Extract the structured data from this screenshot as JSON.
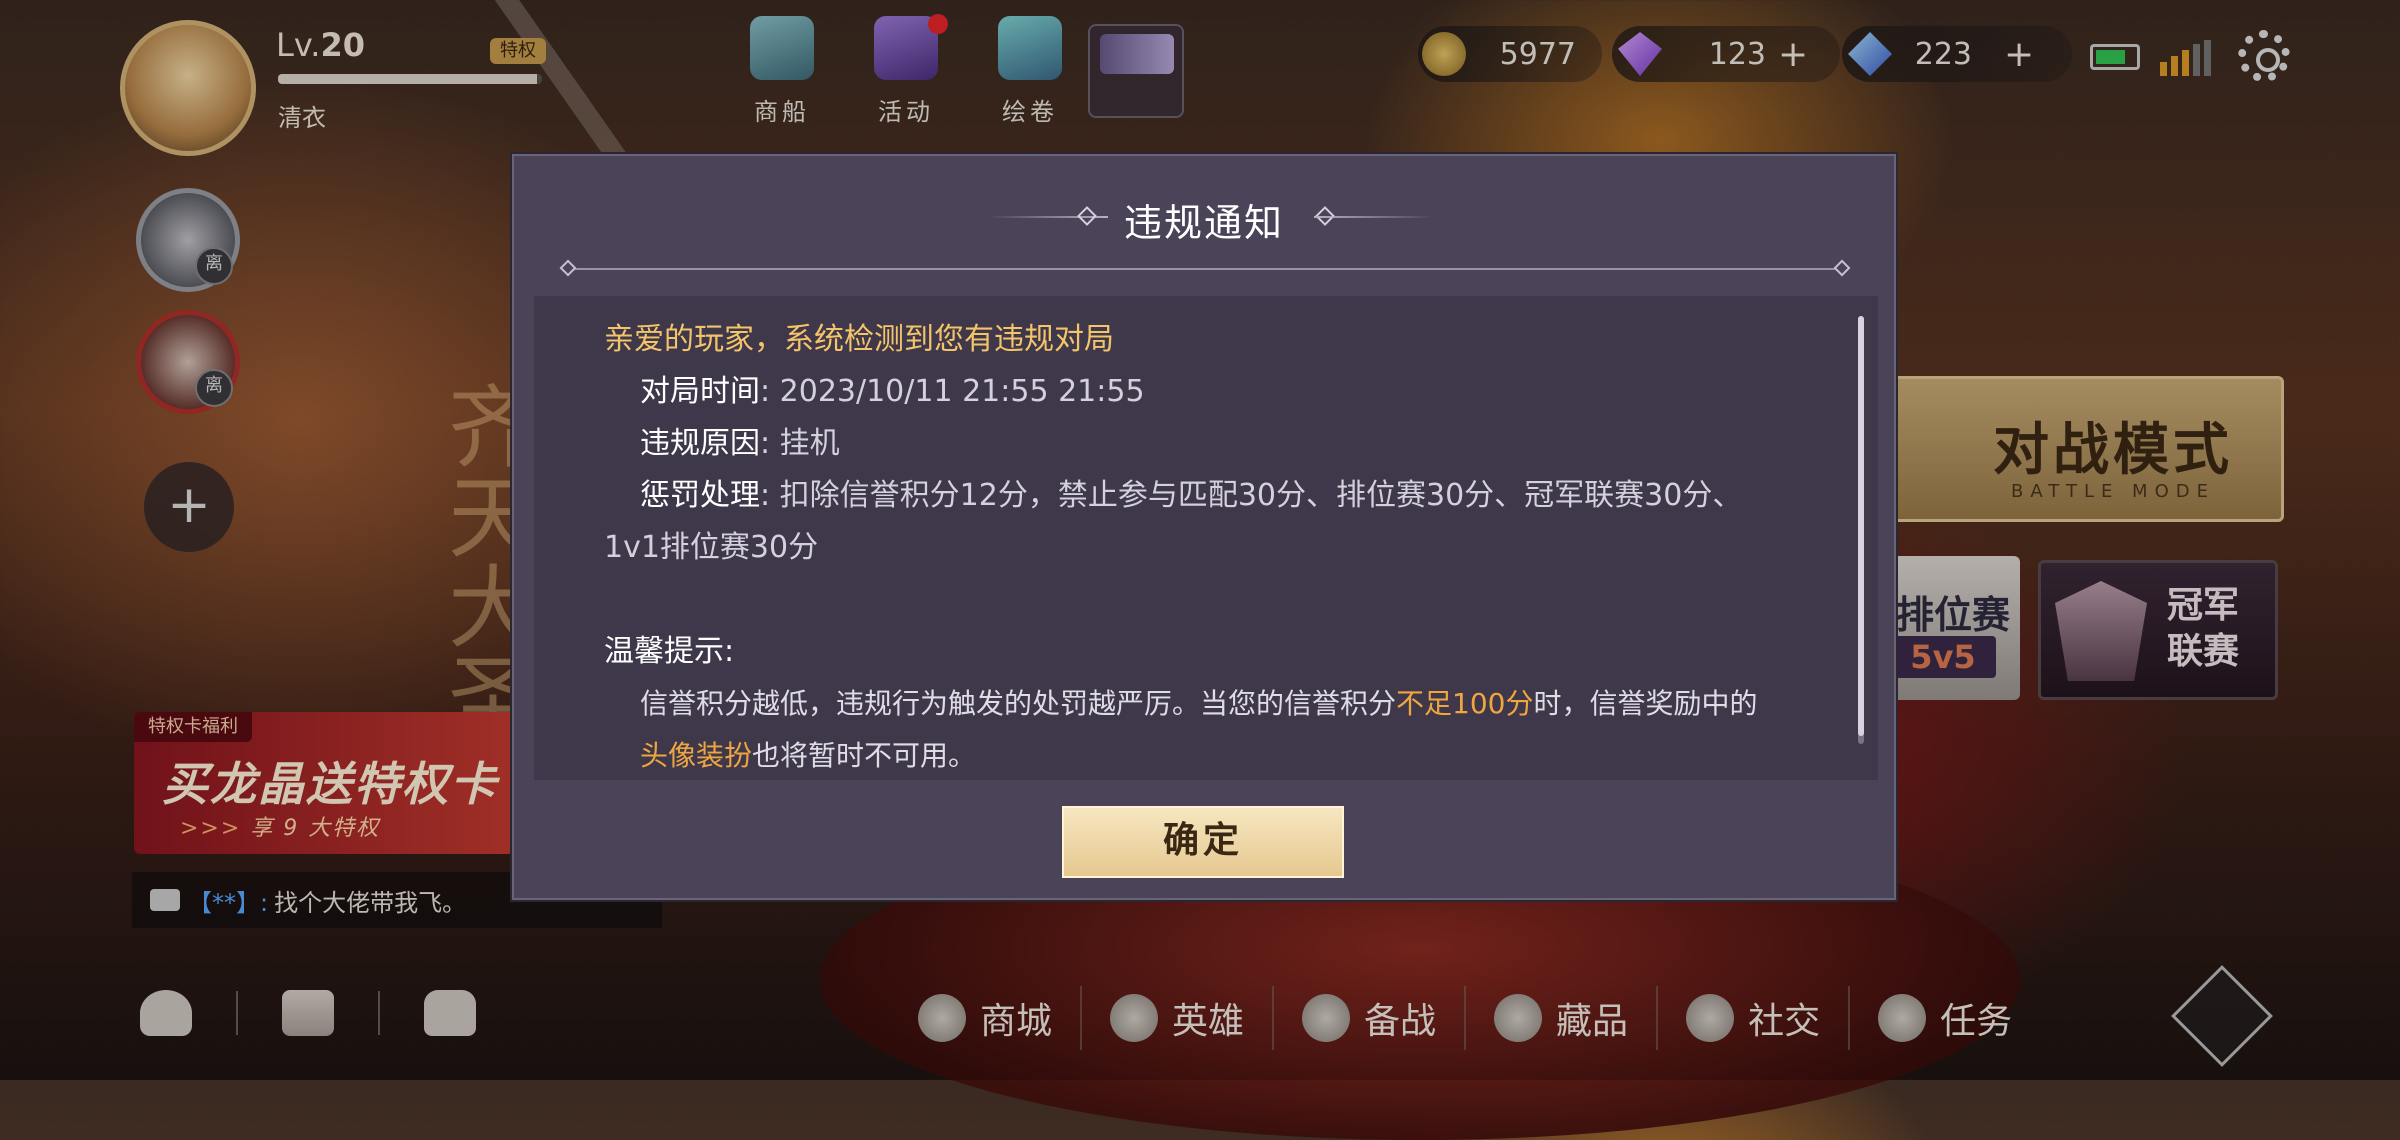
{
  "profile": {
    "level_prefix": "Lv.",
    "level": "20",
    "vip_tag": "特权",
    "name": "清衣",
    "exp_percent": 98
  },
  "friends": {
    "away_badge": "离",
    "add_symbol": "+"
  },
  "topnav": [
    {
      "label": "商船",
      "icon": "ship-icon"
    },
    {
      "label": "活动",
      "icon": "trumpet-icon",
      "notification": true
    },
    {
      "label": "绘卷",
      "icon": "scroll-icon"
    }
  ],
  "currency": {
    "coins": "5977",
    "purple_gems": "123",
    "blue_gems": "223",
    "plus": "+"
  },
  "status": {
    "battery_level": 0.75,
    "signal_bars": 3
  },
  "background_calligraphy": "齐天大圣",
  "battle_mode": {
    "title": "对战模式",
    "subtitle": "BATTLE MODE"
  },
  "ranked": {
    "label": "排位赛",
    "mode": "5v5"
  },
  "champion": {
    "label": "冠军联赛"
  },
  "promo": {
    "tag": "特权卡福利",
    "main": "买龙晶送特权卡",
    "arrows": ">>>",
    "sub": "享 9 大特权"
  },
  "chat": {
    "name": "【**】:",
    "message": "找个大佬带我飞。"
  },
  "bottomnav": [
    {
      "label": "商城"
    },
    {
      "label": "英雄"
    },
    {
      "label": "备战"
    },
    {
      "label": "藏品"
    },
    {
      "label": "社交"
    },
    {
      "label": "任务"
    }
  ],
  "modal": {
    "title": "违规通知",
    "greeting": "亲爱的玩家，系统检测到您有违规对局",
    "time_label": "对局时间",
    "time_value": ": 2023/10/11 21:55 21:55",
    "reason_label": "违规原因",
    "reason_value": ": 挂机",
    "penalty_label": "惩罚处理",
    "penalty_value": ": 扣除信誉积分12分，禁止参与匹配30分、排位赛30分、冠军联赛30分、",
    "penalty_value_2": "1v1排位赛30分",
    "hint_title": "温馨提示:",
    "hint_part1": "信誉积分越低，违规行为触发的处罚越严厉。当您的信誉积分",
    "hint_highlight1": "不足100分",
    "hint_part2": "时，信誉奖励中的",
    "hint_highlight2": "头像装扮",
    "hint_part3": "也将暂时不可用。",
    "confirm": "确定"
  }
}
